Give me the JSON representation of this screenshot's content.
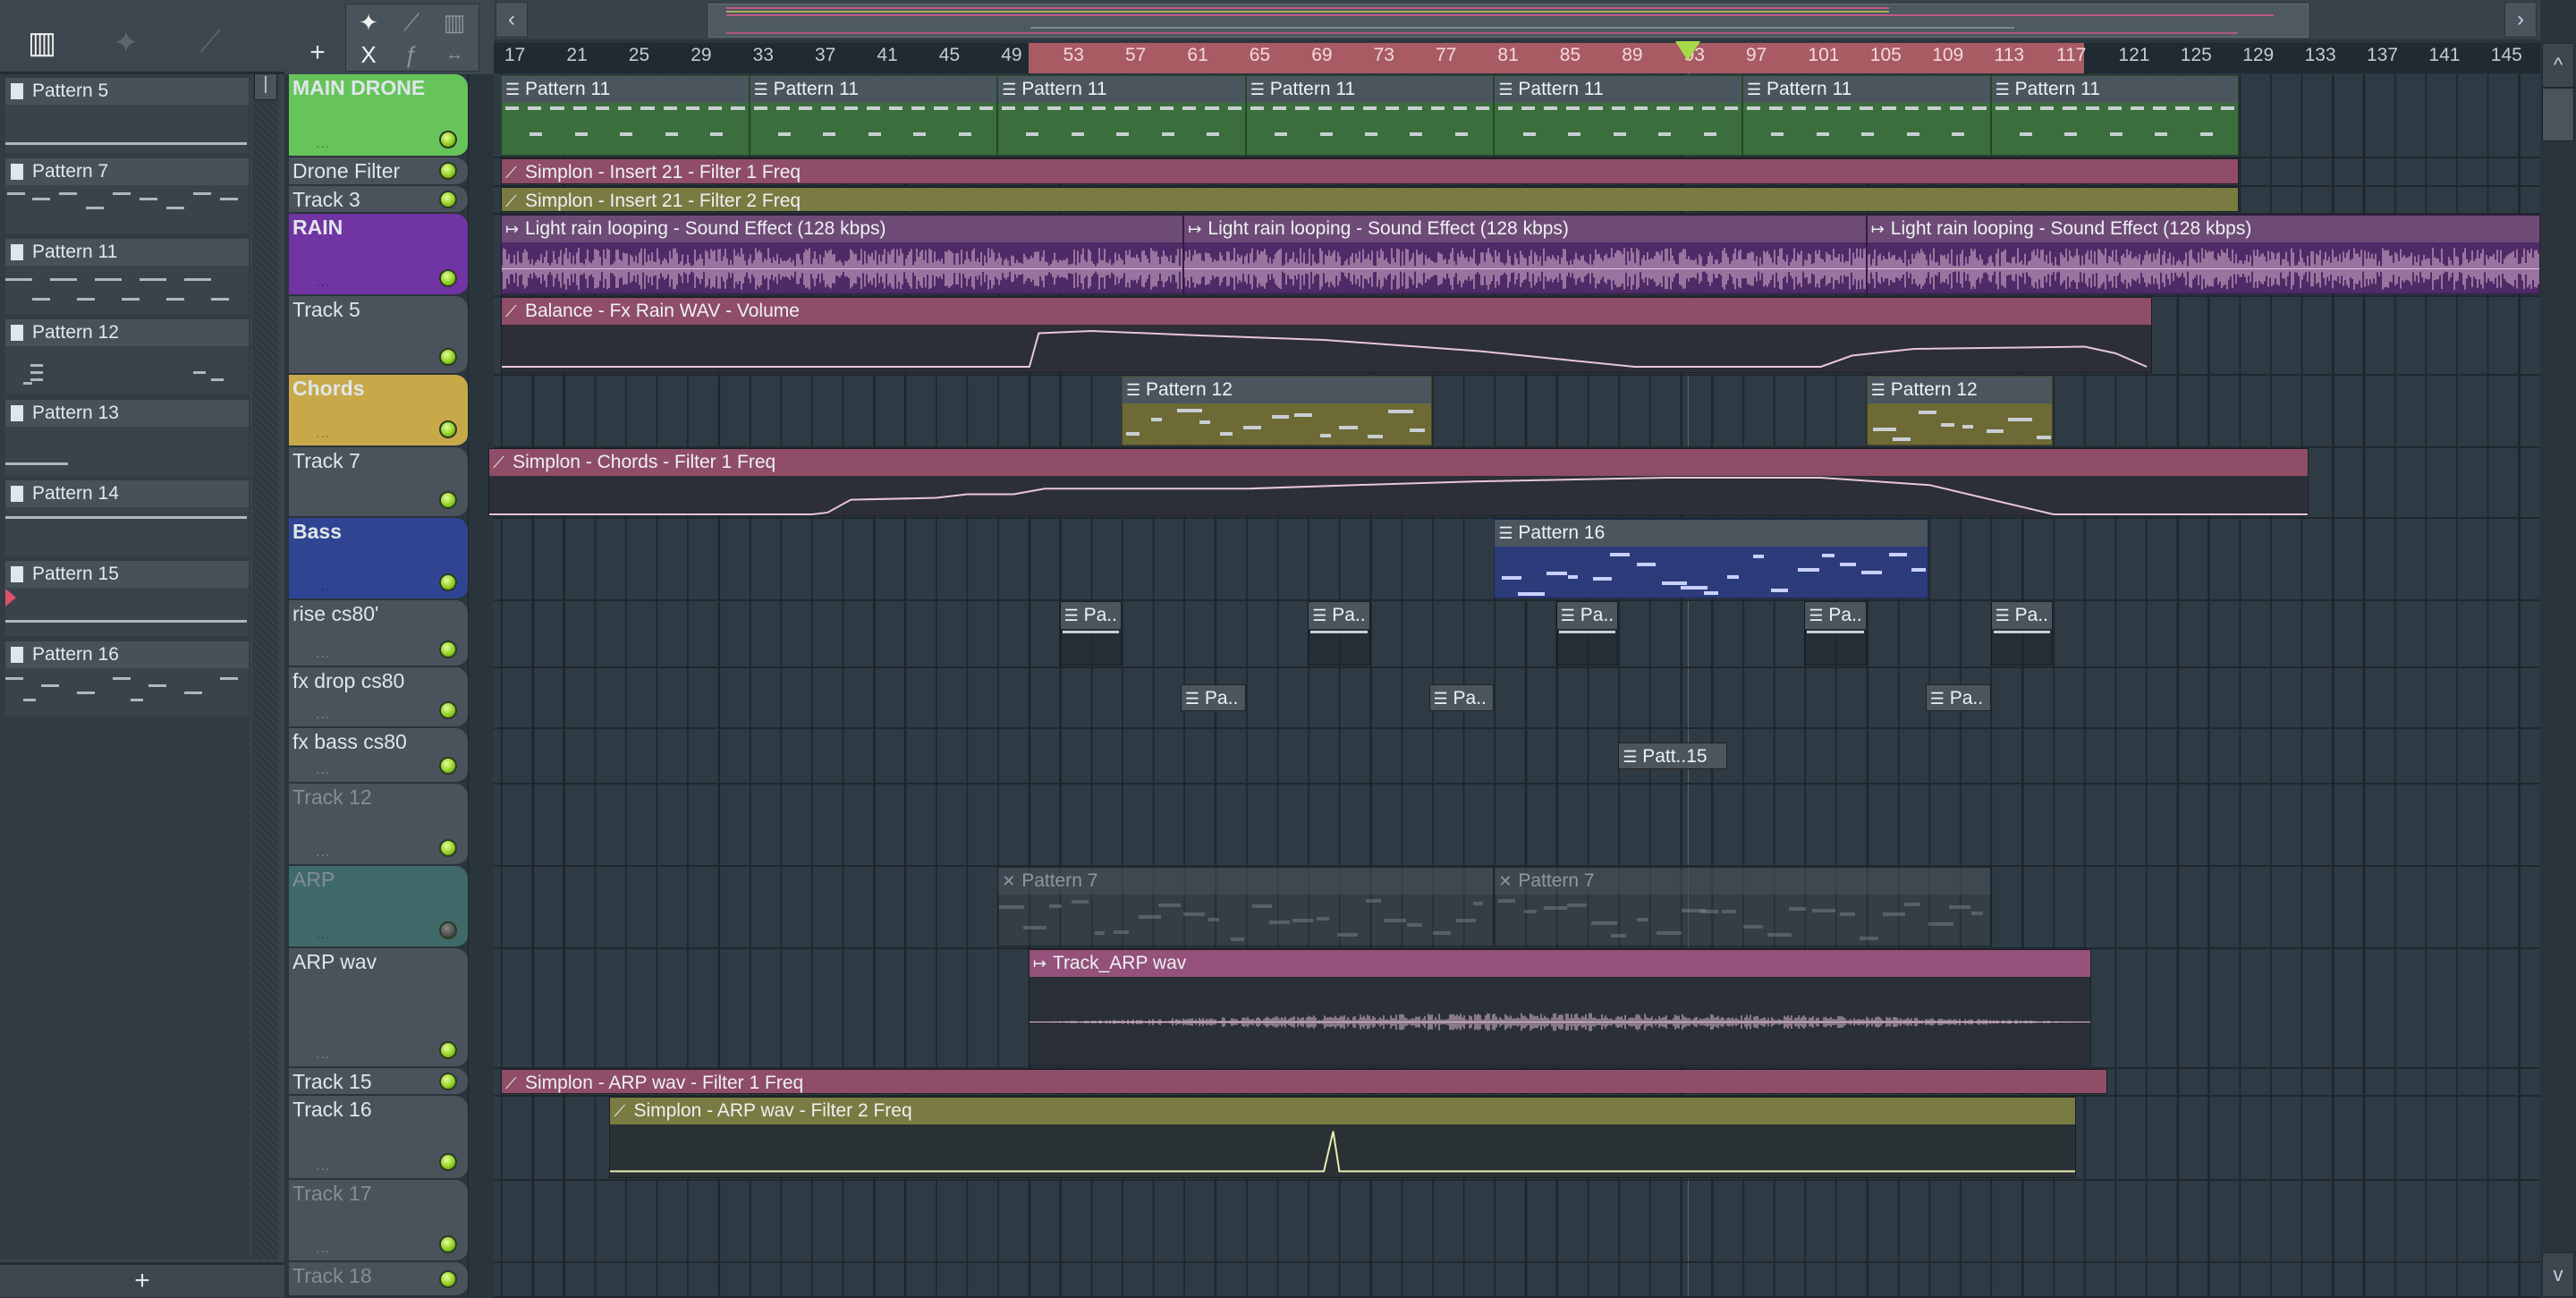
{
  "left_panel": {
    "tools": [
      "piano-roll-icon",
      "audio-icon",
      "automation-icon"
    ],
    "patterns": [
      "Pattern 5",
      "Pattern 7",
      "Pattern 11",
      "Pattern 12",
      "Pattern 13",
      "Pattern 14",
      "Pattern 15",
      "Pattern 16"
    ],
    "add_label": "+"
  },
  "toolbar": {
    "add_track": "+",
    "tools": [
      "audio-icon",
      "automation-icon",
      "piano-roll-icon",
      "delete-icon",
      "slide-icon",
      "stretch-icon"
    ]
  },
  "overview": {
    "prev": "‹",
    "next": "›"
  },
  "ruler": {
    "labels": [
      "17",
      "21",
      "25",
      "29",
      "33",
      "37",
      "41",
      "45",
      "49",
      "53",
      "57",
      "61",
      "65",
      "69",
      "73",
      "77",
      "81",
      "85",
      "89",
      "93",
      "97",
      "101",
      "105",
      "109",
      "113",
      "117",
      "121",
      "125",
      "129",
      "133",
      "137",
      "141",
      "145"
    ],
    "first_bar": 17,
    "last_bar": 145,
    "selection": [
      51,
      119
    ],
    "playhead_bar": 93.5
  },
  "colors": {
    "accent_green": "#a6d94a",
    "selection": "#a85b63",
    "automation": "#8f4d67",
    "olive": "#7a7b42",
    "audio": "#6e4b76"
  },
  "tracks": [
    {
      "name": "MAIN DRONE",
      "color": "#66c45a",
      "bold": true,
      "dots": "...",
      "clips": [
        {
          "label": "Pattern 11",
          "type": "pattern",
          "start": 17,
          "end": 33,
          "body": "#3a6e3c"
        },
        {
          "label": "Pattern 11",
          "type": "pattern",
          "start": 33,
          "end": 49,
          "body": "#3a6e3c"
        },
        {
          "label": "Pattern 11",
          "type": "pattern",
          "start": 49,
          "end": 65,
          "body": "#3a6e3c"
        },
        {
          "label": "Pattern 11",
          "type": "pattern",
          "start": 65,
          "end": 81,
          "body": "#3a6e3c"
        },
        {
          "label": "Pattern 11",
          "type": "pattern",
          "start": 81,
          "end": 97,
          "body": "#3a6e3c"
        },
        {
          "label": "Pattern 11",
          "type": "pattern",
          "start": 97,
          "end": 113,
          "body": "#3a6e3c"
        },
        {
          "label": "Pattern 11",
          "type": "pattern",
          "start": 113,
          "end": 129,
          "body": "#3a6e3c"
        }
      ]
    },
    {
      "name": "Drone Filter",
      "clips": [
        {
          "label": "Simplon - Insert 21 - Filter 1 Freq",
          "type": "automation",
          "start": 17,
          "end": 129
        }
      ]
    },
    {
      "name": "Track 3",
      "clips": [
        {
          "label": "Simplon - Insert 21 - Filter 2 Freq",
          "type": "automation-olive",
          "start": 17,
          "end": 129
        }
      ]
    },
    {
      "name": "RAIN",
      "color": "#7134a3",
      "bold": true,
      "dots": "...",
      "clips": [
        {
          "label": "Light rain looping - Sound Effect (128 kbps)",
          "type": "audio",
          "start": 17,
          "end": 61
        },
        {
          "label": "Light rain looping - Sound Effect (128 kbps)",
          "type": "audio",
          "start": 61,
          "end": 105
        },
        {
          "label": "Light rain looping - Sound Effect (128 kbps)",
          "type": "audio",
          "start": 105,
          "end": 149
        }
      ]
    },
    {
      "name": "Track 5",
      "dots": "",
      "clips": [
        {
          "label": "Balance - Fx Rain WAV - Volume",
          "type": "automation",
          "start": 17,
          "end": 123.4,
          "curve": "t5"
        }
      ]
    },
    {
      "name": "Chords",
      "color": "#c8a94a",
      "bold": true,
      "dots": "...",
      "clips": [
        {
          "label": "Pattern 12",
          "type": "pattern",
          "start": 57,
          "end": 77,
          "body": "#6e6a36"
        },
        {
          "label": "Pattern 12",
          "type": "pattern",
          "start": 105,
          "end": 117,
          "body": "#6e6a36"
        }
      ]
    },
    {
      "name": "Track 7",
      "clips": [
        {
          "label": "Simplon - Chords - Filter 1 Freq",
          "type": "automation",
          "start": 16.2,
          "end": 133.5,
          "curve": "t7"
        }
      ]
    },
    {
      "name": "Bass",
      "color": "#2f4593",
      "bold": true,
      "dots": "...",
      "clips": [
        {
          "label": "Pattern 16",
          "type": "pattern",
          "start": 81,
          "end": 109,
          "body": "#2c3b7a"
        }
      ]
    },
    {
      "name": "rise cs80'",
      "dots": "...",
      "clips": [
        {
          "label": "Pa..",
          "type": "pattern",
          "start": 53,
          "end": 57
        },
        {
          "label": "Pa..",
          "type": "pattern",
          "start": 69,
          "end": 73
        },
        {
          "label": "Pa..",
          "type": "pattern",
          "start": 85,
          "end": 89
        },
        {
          "label": "Pa..",
          "type": "pattern",
          "start": 101,
          "end": 105
        },
        {
          "label": "Pa..",
          "type": "pattern",
          "start": 113,
          "end": 117
        }
      ]
    },
    {
      "name": "fx drop cs80",
      "dots": "...",
      "clips": [
        {
          "label": "Pa..",
          "type": "pattern-center",
          "start": 60.8,
          "end": 65
        },
        {
          "label": "Pa..",
          "type": "pattern-center",
          "start": 76.8,
          "end": 81
        },
        {
          "label": "Pa..",
          "type": "pattern-center",
          "start": 108.8,
          "end": 113
        }
      ]
    },
    {
      "name": "fx bass cs80",
      "dots": "...",
      "clips": [
        {
          "label": "Patt..15",
          "type": "pattern-center",
          "start": 89,
          "end": 96
        }
      ]
    },
    {
      "name": "Track 12",
      "dim": true,
      "dots": "...",
      "clips": []
    },
    {
      "name": "ARP",
      "color": "#406a6a",
      "dim": true,
      "muted": true,
      "dots": "...",
      "clips": [
        {
          "label": "Pattern 7",
          "type": "muted",
          "start": 49,
          "end": 81
        },
        {
          "label": "Pattern 7",
          "type": "muted",
          "start": 81,
          "end": 113
        }
      ]
    },
    {
      "name": "ARP wav",
      "dots": "...",
      "clips": [
        {
          "label": "Track_ARP wav",
          "type": "audio-track",
          "start": 51,
          "end": 119.5
        }
      ]
    },
    {
      "name": "Track 15",
      "clips": [
        {
          "label": "Simplon - ARP wav - Filter 1 Freq",
          "type": "automation",
          "start": 17,
          "end": 120.5
        }
      ]
    },
    {
      "name": "Track 16",
      "dots": "...",
      "clips": [
        {
          "label": "Simplon - ARP wav - Filter 2 Freq",
          "type": "automation-olive",
          "start": 24,
          "end": 118.5,
          "curve": "t16"
        }
      ]
    },
    {
      "name": "Track 17",
      "dim": true,
      "dots": "...",
      "clips": []
    },
    {
      "name": "Track 18",
      "dim": true,
      "clips": []
    }
  ]
}
